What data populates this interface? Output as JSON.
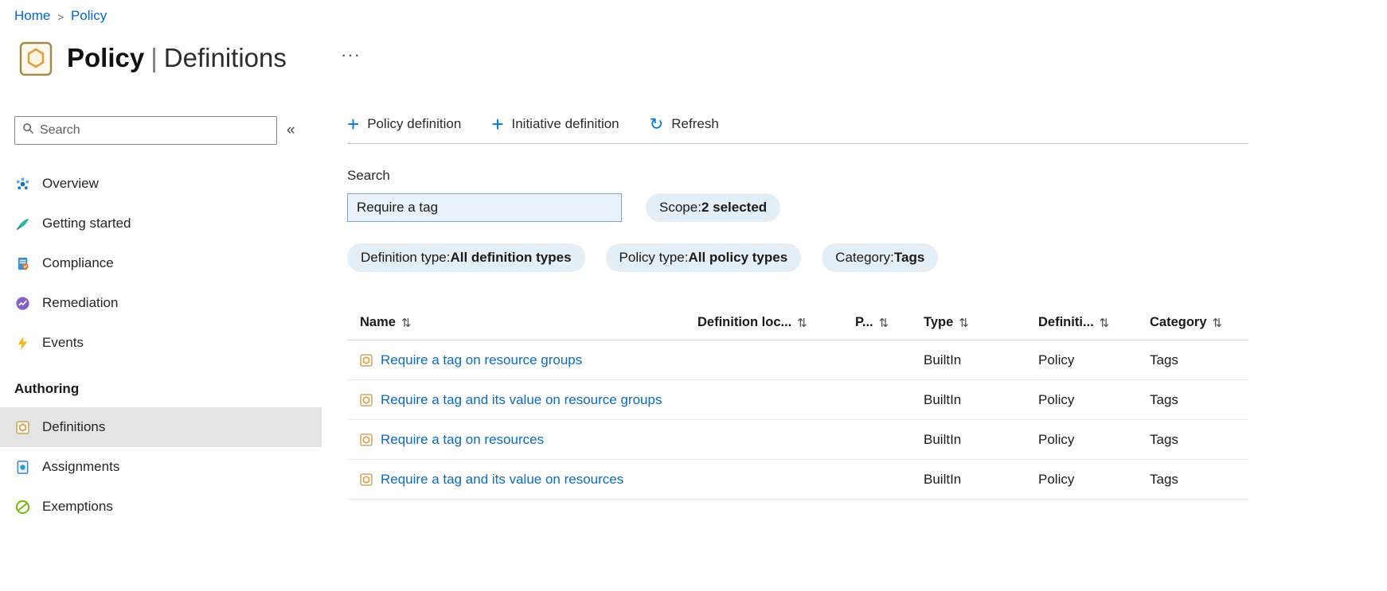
{
  "colors": {
    "accent": "#0078d4",
    "link_blue": "#0b6cbe",
    "breadcrumb_blue": "#0065d9",
    "pill_background": "#e4eef7",
    "selected_item_background": "#e4e4e4",
    "search_input_fill": "#e9f2fb"
  },
  "breadcrumb": {
    "home": "Home",
    "separator": ">",
    "policy": "Policy"
  },
  "header": {
    "title_primary": "Policy",
    "title_separator": "|",
    "title_secondary": "Definitions",
    "more_glyph": "···"
  },
  "sidebar": {
    "search_placeholder": "Search",
    "collapse_glyph": "«",
    "items": [
      {
        "label": "Overview"
      },
      {
        "label": "Getting started"
      },
      {
        "label": "Compliance"
      },
      {
        "label": "Remediation"
      },
      {
        "label": "Events"
      }
    ],
    "section_title": "Authoring",
    "authoring": [
      {
        "label": "Definitions"
      },
      {
        "label": "Assignments"
      },
      {
        "label": "Exemptions"
      }
    ]
  },
  "commandbar": {
    "plus_glyph": "+",
    "refresh_glyph": "↻",
    "policy_definition": "Policy definition",
    "initiative_definition": "Initiative definition",
    "refresh": "Refresh"
  },
  "filters": {
    "search_label": "Search",
    "search_value": "Require a tag",
    "separator": " : ",
    "scope": {
      "label": "Scope",
      "value": "2 selected"
    },
    "pills": [
      {
        "label": "Definition type",
        "value": "All definition types"
      },
      {
        "label": "Policy type",
        "value": "All policy types"
      },
      {
        "label": "Category",
        "value": "Tags"
      }
    ]
  },
  "table": {
    "sort_glyph": "⇅",
    "columns": [
      {
        "label": "Name"
      },
      {
        "label": "Definition loc..."
      },
      {
        "label": "P..."
      },
      {
        "label": "Type"
      },
      {
        "label": "Definiti..."
      },
      {
        "label": "Category"
      }
    ],
    "rows": [
      {
        "name": "Require a tag on resource groups",
        "type": "BuiltIn",
        "definition": "Policy",
        "category": "Tags"
      },
      {
        "name": "Require a tag and its value on resource groups",
        "type": "BuiltIn",
        "definition": "Policy",
        "category": "Tags"
      },
      {
        "name": "Require a tag on resources",
        "type": "BuiltIn",
        "definition": "Policy",
        "category": "Tags"
      },
      {
        "name": "Require a tag and its value on resources",
        "type": "BuiltIn",
        "definition": "Policy",
        "category": "Tags"
      }
    ]
  }
}
